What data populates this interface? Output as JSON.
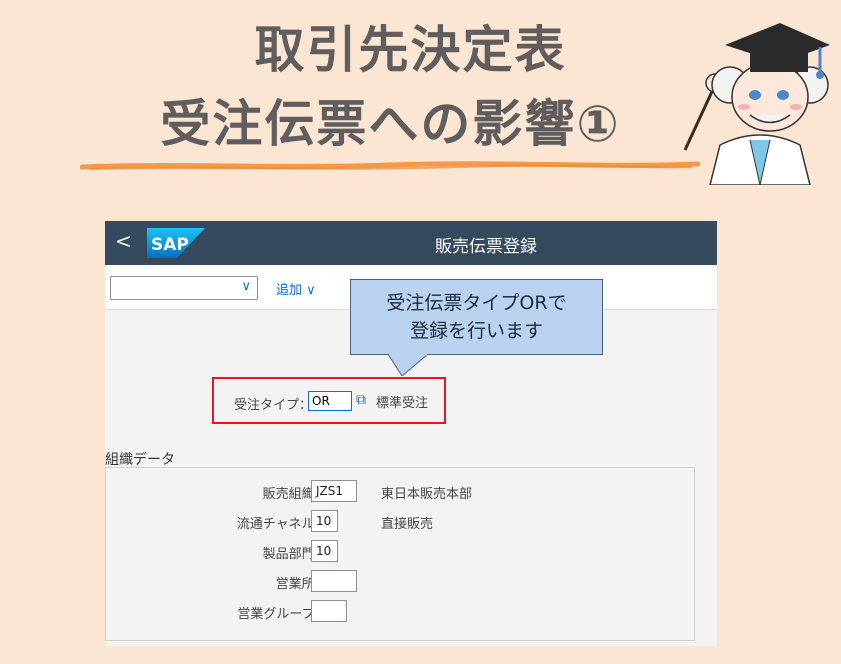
{
  "header": {
    "title_line1": "取引先決定表",
    "title_line2": "受注伝票への影響①"
  },
  "shell": {
    "back_label": "<",
    "logo_text": "SAP",
    "title": "販売伝票登録"
  },
  "toolbar": {
    "select_value": "",
    "add_label": "追加 ∨"
  },
  "callout": {
    "line1": "受注伝票タイプORで",
    "line2": "登録を行います"
  },
  "order_type": {
    "label": "受注タイプ：",
    "required_mark": "*",
    "value": "OR",
    "description": "標準受注"
  },
  "org_data": {
    "section_title": "組織データ",
    "rows": [
      {
        "label": "販売組織:",
        "value": "JZS1",
        "description": "東日本販売本部"
      },
      {
        "label": "流通チャネル:",
        "value": "10",
        "description": "直接販売"
      },
      {
        "label": "製品部門:",
        "value": "10",
        "description": ""
      },
      {
        "label": "営業所:",
        "value": "",
        "description": ""
      },
      {
        "label": "営業グループ:",
        "value": "",
        "description": ""
      }
    ]
  },
  "colors": {
    "background": "#fbe6d3",
    "shell": "#354a5f",
    "highlight_border": "#e8171a",
    "callout_fill": "#b9d2f0",
    "accent": "#0a6ed1"
  }
}
